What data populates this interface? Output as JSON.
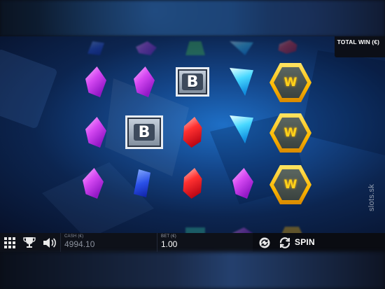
{
  "header": {
    "total_win_label": "TOTAL WIN (€)"
  },
  "watermark": "slots.sk",
  "reels": [
    [
      "purple-gem",
      "purple-gem",
      "purple-gem"
    ],
    [
      "purple-gem",
      "bonus-b",
      "blue-gem"
    ],
    [
      "bonus-b",
      "red-gem",
      "red-gem"
    ],
    [
      "cyan-gem",
      "cyan-gem",
      "purple-gem"
    ],
    [
      "wild-w",
      "wild-w",
      "wild-w"
    ]
  ],
  "symbols": {
    "bonus_letter": "B",
    "wild_letter": "W"
  },
  "toolbar": {
    "cash_label": "CASH (€)",
    "cash_value": "4994.10",
    "bet_label": "BET (€)",
    "bet_value": "1.00",
    "spin_label": "SPIN"
  },
  "icons": [
    "menu-grid-icon",
    "trophy-icon",
    "sound-icon",
    "autoplay-icon",
    "spin-icon"
  ],
  "colors": {
    "bar_bg": "#0e1119",
    "wild_gold": "#ffb800",
    "game_blue": "#1e6fc6"
  }
}
